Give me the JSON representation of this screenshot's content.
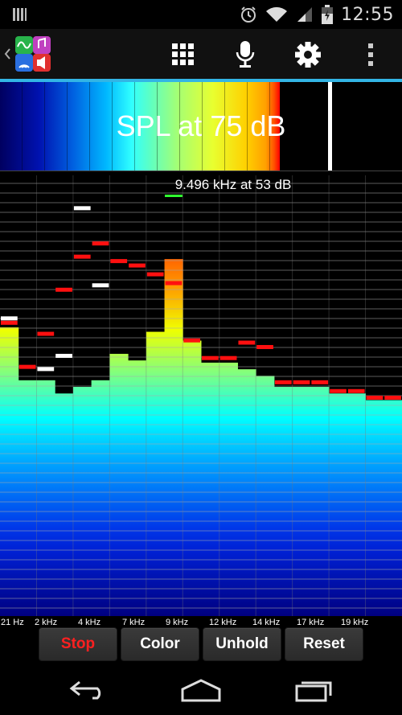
{
  "status": {
    "time": "12:55"
  },
  "spl": {
    "label": "SPL at 75 dB",
    "level_fraction": 0.696,
    "peak_fraction": 0.816
  },
  "spectrum": {
    "peak_label": "9.496 kHz at 53 dB",
    "freq_labels": [
      "21 Hz",
      "2 kHz",
      "4 kHz",
      "7 kHz",
      "9 kHz",
      "12 kHz",
      "14 kHz",
      "17 kHz",
      "19 kHz"
    ],
    "bars": [
      0.655,
      0.535,
      0.535,
      0.505,
      0.52,
      0.535,
      0.595,
      0.58,
      0.645,
      0.81,
      0.625,
      0.575,
      0.575,
      0.56,
      0.545,
      0.52,
      0.52,
      0.52,
      0.505,
      0.505,
      0.49,
      0.49
    ],
    "red_peaks": [
      0.67,
      0.57,
      0.645,
      0.745,
      0.82,
      0.85,
      0.81,
      0.8,
      0.78,
      0.76,
      0.63,
      0.59,
      0.59,
      0.625,
      0.615,
      0.535,
      0.535,
      0.535,
      0.515,
      0.515,
      0.5,
      0.5
    ],
    "white_peaks": [
      0.68,
      null,
      0.565,
      0.595,
      0.93,
      0.755,
      null,
      null,
      null,
      null,
      null,
      null,
      null,
      null,
      null,
      null,
      null,
      null,
      null,
      null,
      null,
      null
    ],
    "peak_bar_index": 9
  },
  "buttons": {
    "stop": "Stop",
    "color": "Color",
    "unhold": "Unhold",
    "reset": "Reset"
  },
  "colors": {
    "accent": "#33b5e5",
    "peak": "#ff1010",
    "stop_text": "#ff2020"
  }
}
